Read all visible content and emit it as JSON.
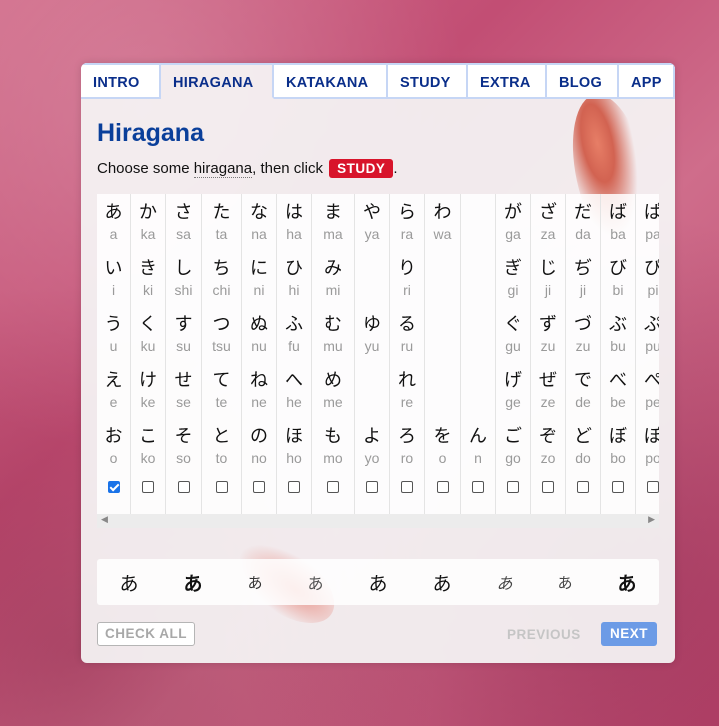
{
  "tabs": [
    "INTRO",
    "HIRAGANA",
    "KATAKANA",
    "STUDY",
    "EXTRA",
    "BLOG",
    "APP"
  ],
  "active_tab": "HIRAGANA",
  "title": "Hiragana",
  "instruction": {
    "before": "Choose some ",
    "term": "hiragana",
    "middle": ", then click ",
    "button": "STUDY",
    "after": "."
  },
  "columns": [
    {
      "cells": [
        [
          "あ",
          "a"
        ],
        [
          "い",
          "i"
        ],
        [
          "う",
          "u"
        ],
        [
          "え",
          "e"
        ],
        [
          "お",
          "o"
        ]
      ],
      "checked": true
    },
    {
      "cells": [
        [
          "か",
          "ka"
        ],
        [
          "き",
          "ki"
        ],
        [
          "く",
          "ku"
        ],
        [
          "け",
          "ke"
        ],
        [
          "こ",
          "ko"
        ]
      ],
      "checked": false
    },
    {
      "cells": [
        [
          "さ",
          "sa"
        ],
        [
          "し",
          "shi"
        ],
        [
          "す",
          "su"
        ],
        [
          "せ",
          "se"
        ],
        [
          "そ",
          "so"
        ]
      ],
      "checked": false
    },
    {
      "cells": [
        [
          "た",
          "ta"
        ],
        [
          "ち",
          "chi"
        ],
        [
          "つ",
          "tsu"
        ],
        [
          "て",
          "te"
        ],
        [
          "と",
          "to"
        ]
      ],
      "checked": false
    },
    {
      "cells": [
        [
          "な",
          "na"
        ],
        [
          "に",
          "ni"
        ],
        [
          "ぬ",
          "nu"
        ],
        [
          "ね",
          "ne"
        ],
        [
          "の",
          "no"
        ]
      ],
      "checked": false
    },
    {
      "cells": [
        [
          "は",
          "ha"
        ],
        [
          "ひ",
          "hi"
        ],
        [
          "ふ",
          "fu"
        ],
        [
          "へ",
          "he"
        ],
        [
          "ほ",
          "ho"
        ]
      ],
      "checked": false
    },
    {
      "cells": [
        [
          "ま",
          "ma"
        ],
        [
          "み",
          "mi"
        ],
        [
          "む",
          "mu"
        ],
        [
          "め",
          "me"
        ],
        [
          "も",
          "mo"
        ]
      ],
      "checked": false
    },
    {
      "cells": [
        [
          "や",
          "ya"
        ],
        [
          "",
          ""
        ],
        [
          "ゆ",
          "yu"
        ],
        [
          "",
          ""
        ],
        [
          "よ",
          "yo"
        ]
      ],
      "checked": false
    },
    {
      "cells": [
        [
          "ら",
          "ra"
        ],
        [
          "り",
          "ri"
        ],
        [
          "る",
          "ru"
        ],
        [
          "れ",
          "re"
        ],
        [
          "ろ",
          "ro"
        ]
      ],
      "checked": false
    },
    {
      "cells": [
        [
          "わ",
          "wa"
        ],
        [
          "",
          ""
        ],
        [
          "",
          ""
        ],
        [
          "",
          ""
        ],
        [
          "を",
          "o"
        ]
      ],
      "checked": false
    },
    {
      "cells": [
        [
          "",
          ""
        ],
        [
          "",
          ""
        ],
        [
          "",
          ""
        ],
        [
          "",
          ""
        ],
        [
          "ん",
          "n"
        ]
      ],
      "checked": false
    },
    {
      "cells": [
        [
          "が",
          "ga"
        ],
        [
          "ぎ",
          "gi"
        ],
        [
          "ぐ",
          "gu"
        ],
        [
          "げ",
          "ge"
        ],
        [
          "ご",
          "go"
        ]
      ],
      "checked": false
    },
    {
      "cells": [
        [
          "ざ",
          "za"
        ],
        [
          "じ",
          "ji"
        ],
        [
          "ず",
          "zu"
        ],
        [
          "ぜ",
          "ze"
        ],
        [
          "ぞ",
          "zo"
        ]
      ],
      "checked": false
    },
    {
      "cells": [
        [
          "だ",
          "da"
        ],
        [
          "ぢ",
          "ji"
        ],
        [
          "づ",
          "zu"
        ],
        [
          "で",
          "de"
        ],
        [
          "ど",
          "do"
        ]
      ],
      "checked": false
    },
    {
      "cells": [
        [
          "ば",
          "ba"
        ],
        [
          "び",
          "bi"
        ],
        [
          "ぶ",
          "bu"
        ],
        [
          "べ",
          "be"
        ],
        [
          "ぼ",
          "bo"
        ]
      ],
      "checked": false
    },
    {
      "cells": [
        [
          "ぱ",
          "pa"
        ],
        [
          "ぴ",
          "pi"
        ],
        [
          "ぷ",
          "pu"
        ],
        [
          "ぺ",
          "pe"
        ],
        [
          "ぽ",
          "po"
        ]
      ],
      "checked": false
    }
  ],
  "font_samples": [
    "あ",
    "あ",
    "あ",
    "あ",
    "あ",
    "あ",
    "あ",
    "あ",
    "あ"
  ],
  "buttons": {
    "check_all": "CHECK ALL",
    "previous": "PREVIOUS",
    "next": "NEXT"
  }
}
